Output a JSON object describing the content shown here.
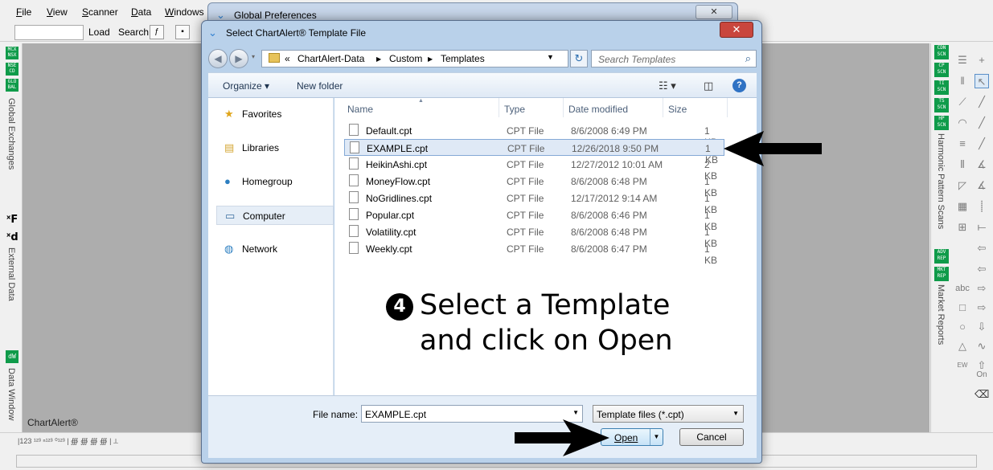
{
  "menu": [
    "File",
    "View",
    "Scanner",
    "Data",
    "Windows"
  ],
  "toolbar": {
    "load_label": "Load",
    "search_label": "Search"
  },
  "left_sidebar": {
    "global_buttons": [
      "MCX NSX",
      "NSE CD",
      "GLO BAL"
    ],
    "global_exchanges_label": "Global Exchanges",
    "external_data_label": "External Data",
    "data_window_label": "Data Window",
    "data_window_button": "dW"
  },
  "right_sidebar": {
    "scan_buttons": [
      "CDN SCN",
      "CP SCN",
      "TI SCN",
      "TS SCN",
      "HP SCN"
    ],
    "harmonic_label": "Harmonic Pattern Scans",
    "report_buttons": [
      "ADV REP",
      "MKT REP"
    ],
    "market_reports_label": "Market Reports",
    "on_label": "On",
    "abc_label": "abc"
  },
  "app_label": "ChartAlert®",
  "global_preferences": {
    "title": "Global Preferences"
  },
  "dialog": {
    "title": "Select ChartAlert® Template File",
    "address": {
      "prefix": "«",
      "segments": [
        "ChartAlert-Data",
        "Custom",
        "Templates"
      ]
    },
    "search_placeholder": "Search Templates",
    "organize_label": "Organize ▾",
    "new_folder_label": "New folder",
    "nav_items": [
      {
        "label": "Favorites",
        "icon": "star-icon"
      },
      {
        "label": "Libraries",
        "icon": "library-icon"
      },
      {
        "label": "Homegroup",
        "icon": "homegroup-icon"
      },
      {
        "label": "Computer",
        "icon": "computer-icon"
      },
      {
        "label": "Network",
        "icon": "network-icon"
      }
    ],
    "columns": [
      "Name",
      "Type",
      "Date modified",
      "Size"
    ],
    "files": [
      {
        "name": "Default.cpt",
        "type": "CPT File",
        "date": "8/6/2008 6:49 PM",
        "size": "1 KB"
      },
      {
        "name": "EXAMPLE.cpt",
        "type": "CPT File",
        "date": "12/26/2018 9:50 PM",
        "size": "1 KB",
        "selected": true
      },
      {
        "name": "HeikinAshi.cpt",
        "type": "CPT File",
        "date": "12/27/2012 10:01 AM",
        "size": "2 KB"
      },
      {
        "name": "MoneyFlow.cpt",
        "type": "CPT File",
        "date": "8/6/2008 6:48 PM",
        "size": "1 KB"
      },
      {
        "name": "NoGridlines.cpt",
        "type": "CPT File",
        "date": "12/17/2012 9:14 AM",
        "size": "1 KB"
      },
      {
        "name": "Popular.cpt",
        "type": "CPT File",
        "date": "8/6/2008 6:46 PM",
        "size": "1 KB"
      },
      {
        "name": "Volatility.cpt",
        "type": "CPT File",
        "date": "8/6/2008 6:48 PM",
        "size": "1 KB"
      },
      {
        "name": "Weekly.cpt",
        "type": "CPT File",
        "date": "8/6/2008 6:47 PM",
        "size": "1 KB"
      }
    ],
    "file_name_label": "File name:",
    "file_name_value": "EXAMPLE.cpt",
    "file_type_value": "Template files (*.cpt)",
    "open_label": "Open",
    "cancel_label": "Cancel"
  },
  "instruction": {
    "step": "4",
    "line1": "Select a Template",
    "line2": "and click on Open"
  }
}
